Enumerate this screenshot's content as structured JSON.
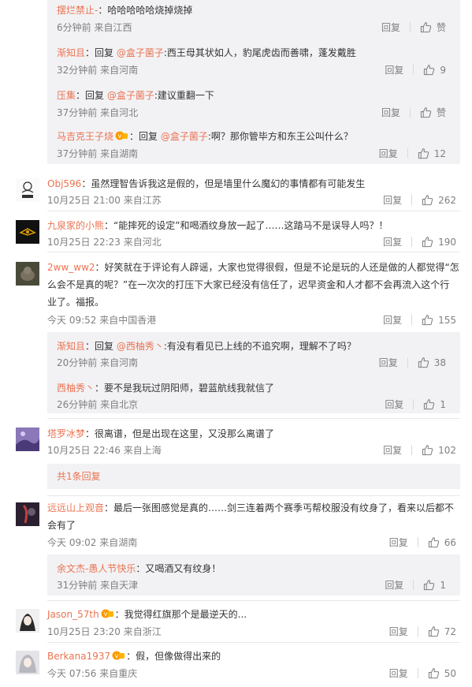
{
  "replies_top": [
    {
      "name": "摆烂禁止-",
      "text": "：哈哈哈哈哈烧掉烧掉",
      "time": "6分钟前",
      "loc": "来自江西",
      "reply": "回复",
      "likes": "赞"
    },
    {
      "name": "渐知且",
      "prefix": "：回复 ",
      "mention": "@盒子菌子",
      "text": ":西王母其状如人，豹尾虎齿而善啸，蓬发戴胜",
      "time": "32分钟前",
      "loc": "来自河南",
      "reply": "回复",
      "likes": "9"
    },
    {
      "name": "压集",
      "prefix": "：回复 ",
      "mention": "@盒子菌子",
      "text": ":建议重翻一下",
      "time": "37分钟前",
      "loc": "来自河北",
      "reply": "回复",
      "likes": "赞"
    },
    {
      "name": "马吉克王子烧",
      "prefix": "：回复 ",
      "mention": "@盒子菌子",
      "text": ":啊？那你管毕方和东王公叫什么？",
      "time": "37分钟前",
      "loc": "来自湖南",
      "reply": "回复",
      "likes": "12"
    }
  ],
  "comments": [
    {
      "name": "Obj596",
      "text": "：虽然理智告诉我这是假的，但是墙里什么魔幻的事情都有可能发生",
      "time": "10月25日 21:00",
      "loc": "来自江苏",
      "reply": "回复",
      "likes": "262"
    },
    {
      "name": "九泉家的小熊",
      "text": "：“能摔死的设定”和喝酒纹身放一起了……这踏马不是误导人吗？！",
      "time": "10月25日 22:23",
      "loc": "来自河北",
      "reply": "回复",
      "likes": "190"
    },
    {
      "name": "2ww_ww2",
      "text1": "：好笑就在于评论有人辟谣，大家也觉得很假，但是不论是玩的人还是做的人都觉得“怎",
      "text2": "么会不是真的呢？”在一次次的打压下大家已经没有信任了，迟早资金和人才都不会再流入这个行",
      "text3": "业了。福报。",
      "time": "今天 09:52",
      "loc": "来自中国香港",
      "reply": "回复",
      "likes": "155"
    },
    {
      "name": "塔罗冰梦",
      "text": "：很离谱，但是出现在这里，又没那么离谱了",
      "time": "10月25日 22:46",
      "loc": "来自上海",
      "reply": "回复",
      "likes": "102"
    },
    {
      "name": "远远山上观音",
      "text1": "：最后一张图感觉是真的……剑三连着两个赛季丐帮校服没有纹身了，看来以后都不",
      "text2": "会有了",
      "time": "今天 09:02",
      "loc": "来自湖南",
      "reply": "回复",
      "likes": "66"
    },
    {
      "name": "Jason_57th",
      "text": "：我觉得红旗那个是最逆天的...",
      "time": "10月25日 23:20",
      "loc": "来自浙江",
      "reply": "回复",
      "likes": "72"
    },
    {
      "name": "Berkana1937",
      "text": "：假，但像做得出来的",
      "time": "今天 07:56",
      "loc": "来自重庆",
      "reply": "回复",
      "likes": "50"
    }
  ],
  "replies_mid": [
    {
      "name": "渐知且",
      "prefix": "：回复 ",
      "mention": "@西柚秀丶",
      "text": ":有没有看见已上线的不追究啊，理解不了吗？",
      "time": "20分钟前",
      "loc": "来自河南",
      "reply": "回复",
      "likes": "38"
    },
    {
      "name": "西柚秀丶",
      "text": "：要不是我玩过阴阳师，碧蓝航线我就信了",
      "time": "26分钟前",
      "loc": "来自北京",
      "reply": "回复",
      "likes": "1"
    }
  ],
  "fold_text": "共1条回复",
  "reply_late": {
    "name": "余文杰-愚人节快乐",
    "text": "：又喝酒又有纹身！",
    "time": "31分钟前",
    "loc": "来自天津",
    "reply": "回复",
    "likes": "1"
  },
  "colors": {
    "name": "#eb7350",
    "meta": "#808080",
    "replybox": "#f2f2f5"
  }
}
